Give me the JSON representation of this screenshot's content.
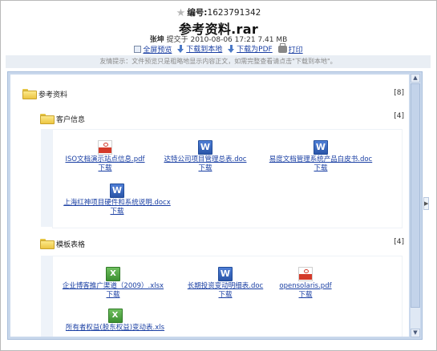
{
  "header": {
    "number_label": "编号:",
    "number_value": "1623791342",
    "title": "参考资料.rar",
    "author": "张坤",
    "submitted_label": "提交于",
    "date": "2010-08-06 17:21",
    "size": "7.41 MB"
  },
  "actions": {
    "preview": "全屏预览",
    "download_local": "下载到本地",
    "download_pdf": "下载为PDF",
    "print": "打印"
  },
  "notice": "友情提示：文件预览只是粗略地显示内容正文，如需完整查看请点击\"下载到本地\"。",
  "tree": {
    "root": {
      "name": "参考资料",
      "count": "[8]"
    },
    "folders": [
      {
        "name": "客户信息",
        "count": "[4]",
        "files": [
          {
            "name": "ISO文档演示站点信息.pdf",
            "type": "pdf",
            "download": "下载"
          },
          {
            "name": "达特公司项目管理总表.doc",
            "type": "doc",
            "download": "下载"
          },
          {
            "name": "易度文档管理系统产品白皮书.doc",
            "type": "doc",
            "download": "下载"
          },
          {
            "name": "上海红神项目硬件和系统说明.docx",
            "type": "doc",
            "download": "下载"
          }
        ]
      },
      {
        "name": "模板表格",
        "count": "[4]",
        "files": [
          {
            "name": "企业博客推广渠道（2009）.xlsx",
            "type": "xls",
            "download": "下载"
          },
          {
            "name": "长期投资变动明细表.doc",
            "type": "doc",
            "download": "下载"
          },
          {
            "name": "opensolaris.pdf",
            "type": "pdf",
            "download": "下载"
          },
          {
            "name": "所有者权益(股东权益)变动表.xls",
            "type": "xls",
            "download": ""
          }
        ]
      }
    ]
  },
  "icons": {
    "star": "star-icon",
    "preview": "preview-icon",
    "download": "download-arrow-icon",
    "print": "print-icon",
    "folder": "folder-icon",
    "pdf": "pdf-file-icon",
    "doc": "word-file-icon",
    "xls": "excel-file-icon"
  },
  "colors": {
    "link": "#1a3fa3",
    "viewer_border": "#c9d8ec",
    "notice_bg": "#e9eef4"
  }
}
